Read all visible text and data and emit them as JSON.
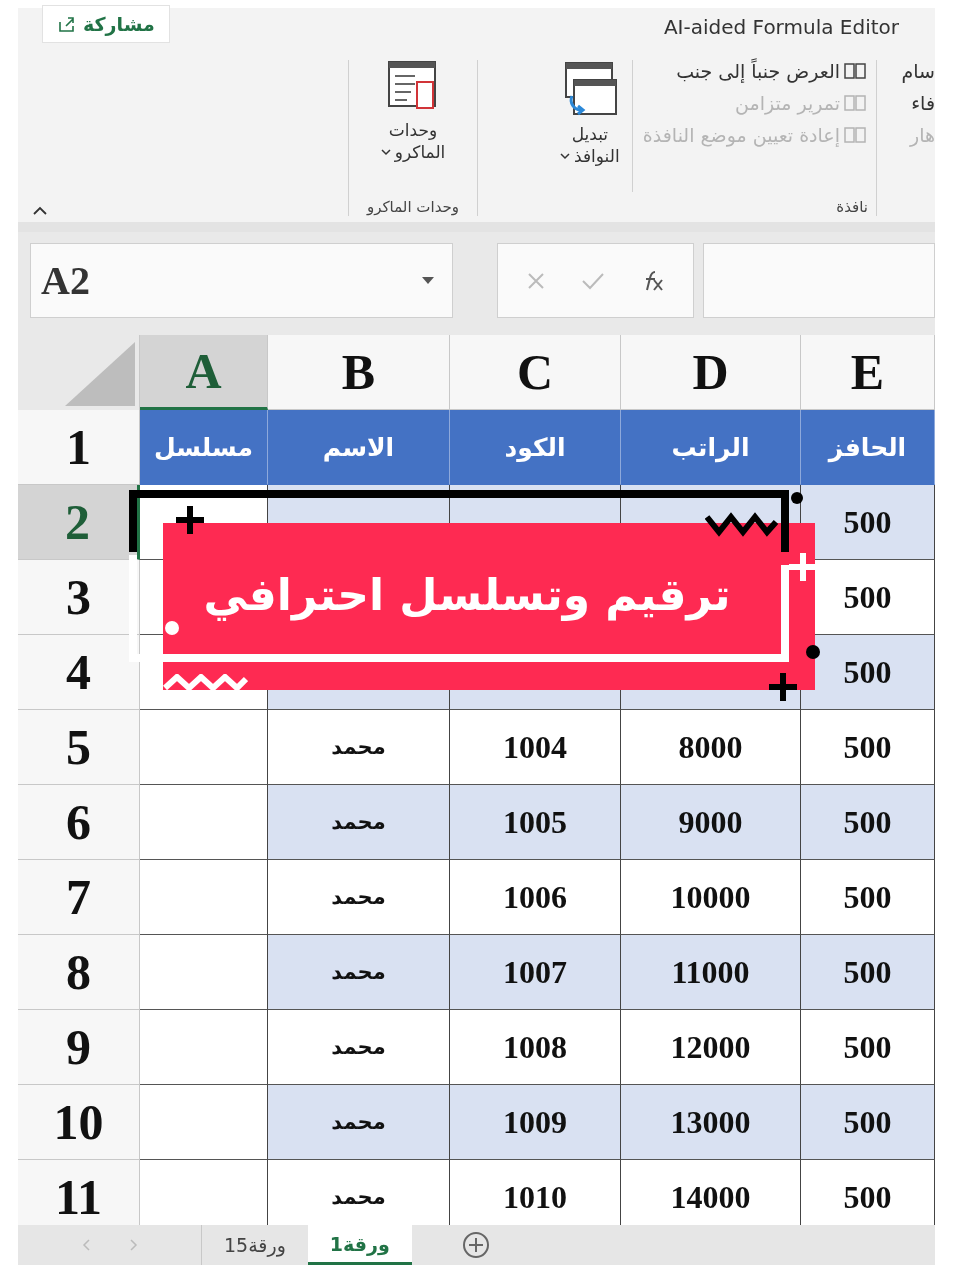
{
  "title": "AI-aided Formula Editor",
  "share": {
    "label": "مشاركة"
  },
  "partial_group": {
    "commands": [
      {
        "label": "سام",
        "disabled": false
      },
      {
        "label": "فاء",
        "disabled": false
      },
      {
        "label": "هار",
        "disabled": true
      }
    ]
  },
  "window_group": {
    "label": "نافذة",
    "commands": [
      {
        "label": "العرض جنباً إلى جنب",
        "disabled": false
      },
      {
        "label": "تمرير متزامن",
        "disabled": true
      },
      {
        "label": "إعادة تعيين موضع النافذة",
        "disabled": true
      }
    ],
    "switch_button": {
      "lines": [
        "تبديل",
        "النوافذ"
      ]
    }
  },
  "macro_group": {
    "label": "وحدات الماكرو",
    "button": {
      "lines": [
        "وحدات",
        "الماكرو"
      ]
    }
  },
  "formula_bar": {
    "name_box": "A2"
  },
  "columns": [
    {
      "label": "E",
      "selected": false
    },
    {
      "label": "D",
      "selected": false
    },
    {
      "label": "C",
      "selected": false
    },
    {
      "label": "B",
      "selected": false
    },
    {
      "label": "A",
      "selected": true
    }
  ],
  "rows": [
    {
      "number": "1",
      "selected": false,
      "kind": "header",
      "cells": [
        "الحافز",
        "الراتب",
        "الكود",
        "الاسم",
        "مسلسل"
      ]
    },
    {
      "number": "2",
      "selected": true,
      "kind": "data",
      "cells": [
        "500",
        null,
        null,
        null,
        null
      ]
    },
    {
      "number": "3",
      "selected": false,
      "kind": "data",
      "cells": [
        "500",
        null,
        null,
        null,
        null
      ]
    },
    {
      "number": "4",
      "selected": false,
      "kind": "data",
      "cells": [
        "500",
        null,
        null,
        null,
        null
      ]
    },
    {
      "number": "5",
      "selected": false,
      "kind": "data",
      "cells": [
        "500",
        "8000",
        "1004",
        "محمد",
        null
      ]
    },
    {
      "number": "6",
      "selected": false,
      "kind": "data",
      "cells": [
        "500",
        "9000",
        "1005",
        "محمد",
        null
      ]
    },
    {
      "number": "7",
      "selected": false,
      "kind": "data",
      "cells": [
        "500",
        "10000",
        "1006",
        "محمد",
        null
      ]
    },
    {
      "number": "8",
      "selected": false,
      "kind": "data",
      "cells": [
        "500",
        "11000",
        "1007",
        "محمد",
        null
      ]
    },
    {
      "number": "9",
      "selected": false,
      "kind": "data",
      "cells": [
        "500",
        "12000",
        "1008",
        "محمد",
        null
      ]
    },
    {
      "number": "10",
      "selected": false,
      "kind": "data",
      "cells": [
        "500",
        "13000",
        "1009",
        "محمد",
        null
      ]
    },
    {
      "number": "11",
      "selected": false,
      "kind": "data",
      "cells": [
        "500",
        "14000",
        "1010",
        "محمد",
        null
      ]
    }
  ],
  "banner": {
    "text": "ترقيم وتسلسل احترافي"
  },
  "sheet_tabs": [
    {
      "label": "ورقة1",
      "selected": true
    },
    {
      "label": "ورقة15",
      "selected": false
    }
  ]
}
